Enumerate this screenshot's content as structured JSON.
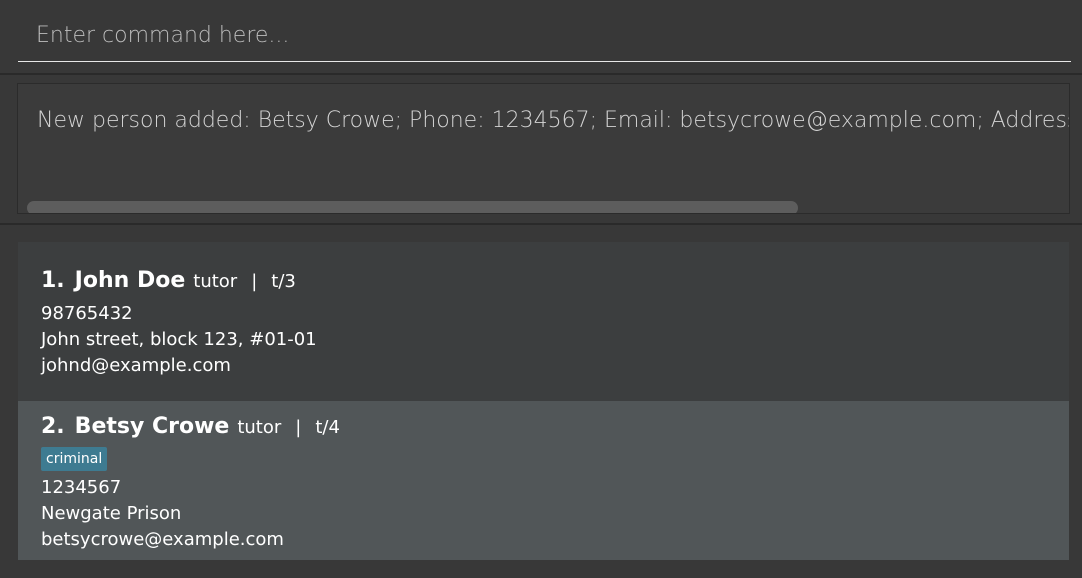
{
  "command": {
    "placeholder": "Enter command here...",
    "value": ""
  },
  "result": {
    "text": "New person added: Betsy Crowe; Phone: 1234567; Email: betsycrowe@example.com; Address: Newgate Prison; Tags: [criminal]"
  },
  "persons": [
    {
      "index": "1.",
      "name": "John Doe",
      "role": "tutor",
      "separator": "|",
      "tutorial": "t/3",
      "tags": [],
      "phone": "98765432",
      "address": "John street, block 123, #01-01",
      "email": "johnd@example.com"
    },
    {
      "index": "2.",
      "name": "Betsy Crowe",
      "role": "tutor",
      "separator": "|",
      "tutorial": "t/4",
      "tags": [
        "criminal"
      ],
      "phone": "1234567",
      "address": "Newgate Prison",
      "email": "betsycrowe@example.com"
    }
  ],
  "colors": {
    "background": "#383838",
    "card_default": "#3c3e3f",
    "card_selected": "#515658",
    "tag": "#3e7b91",
    "input_underline": "#e8e8e8"
  }
}
